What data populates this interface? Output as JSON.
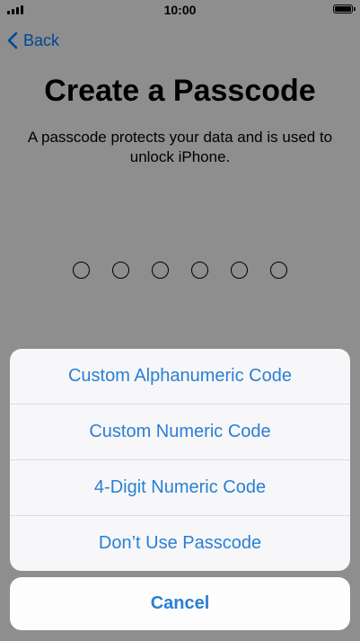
{
  "status_bar": {
    "time": "10:00",
    "signal_icon": "signal-bars-icon",
    "battery_icon": "battery-full-icon"
  },
  "nav": {
    "back_label": "Back",
    "back_icon": "chevron-left-icon"
  },
  "main": {
    "title": "Create a Passcode",
    "subtitle": "A passcode protects your data and is used to unlock iPhone.",
    "passcode_length": 6
  },
  "action_sheet": {
    "options": [
      {
        "label": "Custom Alphanumeric Code"
      },
      {
        "label": "Custom Numeric Code"
      },
      {
        "label": "4-Digit Numeric Code"
      },
      {
        "label": "Don’t Use Passcode"
      }
    ],
    "cancel_label": "Cancel"
  },
  "colors": {
    "accent": "#2a7fd4",
    "dim_overlay": "rgba(0,0,0,0.42)"
  }
}
